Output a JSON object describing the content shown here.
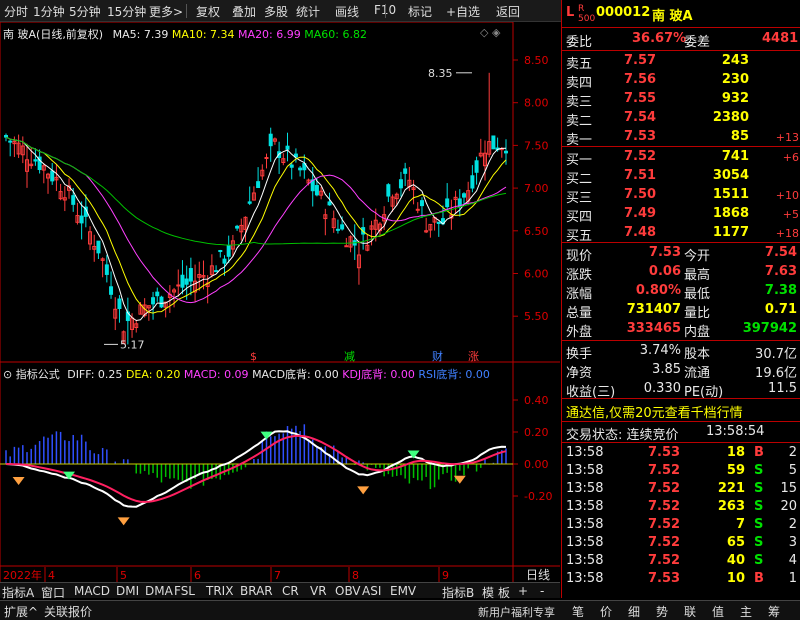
{
  "toolbar": {
    "items": [
      "分时",
      "1分钟",
      "5分钟",
      "15分钟",
      "更多>",
      "复权",
      "叠加",
      "多股",
      "统计",
      "画线",
      "F10",
      "标记",
      "+自选",
      "返回"
    ]
  },
  "chart_title": {
    "stock": "南 玻A(日线,前复权)",
    "ma5_label": "MA5: 7.39",
    "ma10_label": "MA10: 7.34",
    "ma20_label": "MA20: 6.99",
    "ma60_label": "MA60: 6.82"
  },
  "price_axis": [
    "8.50",
    "8.00",
    "7.50",
    "7.00",
    "6.50",
    "6.00",
    "5.50"
  ],
  "annotations": {
    "high": "8.35",
    "low": "5.17"
  },
  "event_marks": [
    "$",
    "减",
    "财",
    "涨"
  ],
  "indicator_title": {
    "name": "指标公式",
    "diff": "DIFF: 0.25",
    "dea": "DEA: 0.20",
    "macd": "MACD: 0.09",
    "bottom": "MACD底背: 0.00",
    "kdj": "KDJ底背: 0.00",
    "rsi": "RSI底背: 0.00"
  },
  "indicator_axis": [
    "0.40",
    "0.20",
    "0.00",
    "-0.20"
  ],
  "date_axis": {
    "year": "2022年",
    "months": [
      "4",
      "5",
      "6",
      "7",
      "8",
      "9"
    ],
    "period": "日线"
  },
  "bottom_tabs": [
    "指标A",
    "窗口",
    "MACD",
    "DMI",
    "DMA",
    "FSL",
    "TRIX",
    "BRAR",
    "CR",
    "VR",
    "OBV",
    "ASI",
    "EMV",
    "指标B",
    "模",
    "板",
    "+",
    "-"
  ],
  "quote": {
    "code": "000012",
    "name": "南 玻A",
    "weibi_label": "委比",
    "weibi_value": "36.67%",
    "weicha_label": "委差",
    "weicha_value": "4481",
    "asks": [
      {
        "label": "卖五",
        "price": "7.57",
        "vol": "243",
        "chg": ""
      },
      {
        "label": "卖四",
        "price": "7.56",
        "vol": "230",
        "chg": ""
      },
      {
        "label": "卖三",
        "price": "7.55",
        "vol": "932",
        "chg": ""
      },
      {
        "label": "卖二",
        "price": "7.54",
        "vol": "2380",
        "chg": ""
      },
      {
        "label": "卖一",
        "price": "7.53",
        "vol": "85",
        "chg": "+13"
      }
    ],
    "bids": [
      {
        "label": "买一",
        "price": "7.52",
        "vol": "741",
        "chg": "+6"
      },
      {
        "label": "买二",
        "price": "7.51",
        "vol": "3054",
        "chg": ""
      },
      {
        "label": "买三",
        "price": "7.50",
        "vol": "1511",
        "chg": "+10"
      },
      {
        "label": "买四",
        "price": "7.49",
        "vol": "1868",
        "chg": "+5"
      },
      {
        "label": "买五",
        "price": "7.48",
        "vol": "1177",
        "chg": "+18"
      }
    ],
    "stats": [
      {
        "l1": "现价",
        "v1": "7.53",
        "c1": "red",
        "l2": "今开",
        "v2": "7.54",
        "c2": "red"
      },
      {
        "l1": "涨跌",
        "v1": "0.06",
        "c1": "red",
        "l2": "最高",
        "v2": "7.63",
        "c2": "red"
      },
      {
        "l1": "涨幅",
        "v1": "0.80%",
        "c1": "red",
        "l2": "最低",
        "v2": "7.38",
        "c2": "grn"
      },
      {
        "l1": "总量",
        "v1": "731407",
        "c1": "yel",
        "l2": "量比",
        "v2": "0.71",
        "c2": "yel"
      },
      {
        "l1": "外盘",
        "v1": "333465",
        "c1": "red",
        "l2": "内盘",
        "v2": "397942",
        "c2": "grn"
      }
    ],
    "fund": [
      {
        "l1": "换手",
        "v1": "3.74%",
        "l2": "股本",
        "v2": "30.7亿"
      },
      {
        "l1": "净资",
        "v1": "3.85",
        "l2": "流通",
        "v2": "19.6亿"
      },
      {
        "l1": "收益(三)",
        "v1": "0.330",
        "l2": "PE(动)",
        "v2": "11.5"
      }
    ],
    "ad_text": "通达信,仅需20元查看千档行情",
    "trade_status_label": "交易状态: 连续竞价",
    "trade_time": "13:58:54",
    "ticks": [
      {
        "t": "13:58",
        "p": "7.53",
        "pc": "red",
        "v": "18",
        "s": "B",
        "sc": "red",
        "n": "2"
      },
      {
        "t": "13:58",
        "p": "7.52",
        "pc": "red",
        "v": "59",
        "s": "S",
        "sc": "grn",
        "n": "5"
      },
      {
        "t": "13:58",
        "p": "7.52",
        "pc": "red",
        "v": "221",
        "s": "S",
        "sc": "grn",
        "n": "15"
      },
      {
        "t": "13:58",
        "p": "7.52",
        "pc": "red",
        "v": "263",
        "s": "S",
        "sc": "grn",
        "n": "20"
      },
      {
        "t": "13:58",
        "p": "7.52",
        "pc": "red",
        "v": "7",
        "s": "S",
        "sc": "grn",
        "n": "2"
      },
      {
        "t": "13:58",
        "p": "7.52",
        "pc": "red",
        "v": "65",
        "s": "S",
        "sc": "grn",
        "n": "3"
      },
      {
        "t": "13:58",
        "p": "7.52",
        "pc": "red",
        "v": "40",
        "s": "S",
        "sc": "grn",
        "n": "4"
      },
      {
        "t": "13:58",
        "p": "7.53",
        "pc": "red",
        "v": "10",
        "s": "B",
        "sc": "red",
        "n": "1"
      }
    ]
  },
  "footer": {
    "left": [
      "扩展^",
      "关联报价"
    ],
    "promo": "新用户福利专享",
    "tabs": [
      "笔",
      "价",
      "细",
      "势",
      "联",
      "值",
      "主",
      "筹"
    ]
  },
  "colors": {
    "up": "#ff3c3c",
    "down": "#00e0e0",
    "ma5": "#ffffff",
    "ma10": "#ffff00",
    "ma20": "#ff40ff",
    "ma60": "#00c000",
    "bg": "#000000"
  }
}
